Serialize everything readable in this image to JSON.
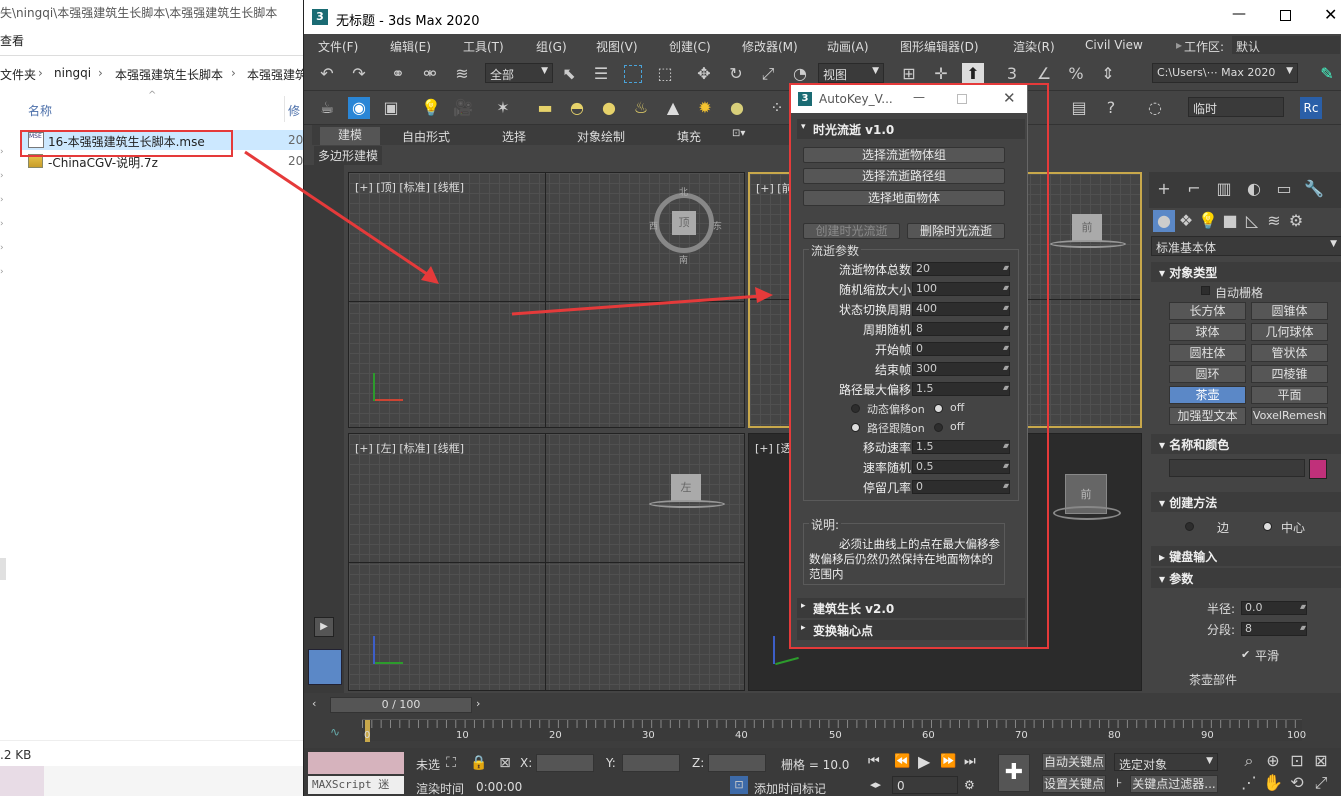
{
  "explorer": {
    "path_line": "失\\ningqi\\本强强建筑生长脚本\\本强强建筑生长脚本",
    "view_menu": "查看",
    "breadcrumb": [
      "文件夹",
      "ningqi",
      "本强强建筑生长脚本",
      "本强强建筑"
    ],
    "column_name": "名称",
    "column_modified": "修",
    "files": [
      {
        "name": "16-本强强建筑生长脚本.mse",
        "icon": "mse-file-icon",
        "date_prefix": "20"
      },
      {
        "name": "-ChinaCGV-说明.7z",
        "icon": "archive-icon",
        "date_prefix": "20"
      }
    ],
    "status_size": ".2 KB"
  },
  "max": {
    "title": "无标题 - 3ds Max 2020",
    "menu": [
      "文件(F)",
      "编辑(E)",
      "工具(T)",
      "组(G)",
      "视图(V)",
      "创建(C)",
      "修改器(M)",
      "动画(A)",
      "图形编辑器(D)",
      "渲染(R)",
      "Civil View"
    ],
    "workspace_label": "工作区:",
    "workspace_value": "默认",
    "selection_filter": "全部",
    "ref_coord": "视图",
    "path_display": "C:\\Users\\⋯ Max 2020",
    "named_set": "临时",
    "ribbon_tabs": [
      "建模",
      "自由形式",
      "选择",
      "对象绘制",
      "填充"
    ],
    "ribbon_sub": "多边形建模",
    "viewports": [
      {
        "label": "[+] [顶] [标准] [线框]"
      },
      {
        "label": "[+] [前"
      },
      {
        "label": "[+] [左] [标准] [线框]"
      },
      {
        "label": "[+] [透"
      }
    ],
    "viewcube_labels": {
      "top": "北",
      "left": "西",
      "right": "东",
      "bottom": "南",
      "top_face": "顶",
      "front_face": "前",
      "left_face": "左"
    },
    "command_panel": {
      "category": "标准基本体",
      "object_type_header": "对象类型",
      "auto_grid": "自动栅格",
      "buttons": [
        "长方体",
        "圆锥体",
        "球体",
        "几何球体",
        "圆柱体",
        "管状体",
        "圆环",
        "四棱锥",
        "茶壶",
        "平面",
        "加强型文本",
        "VoxelRemesh"
      ],
      "name_color_header": "名称和颜色",
      "object_color": "#c0307a",
      "creation_method_header": "创建方法",
      "edge_label": "边",
      "center_label": "中心",
      "keyboard_header": "键盘输入",
      "params_header": "参数",
      "radius_label": "半径:",
      "radius_value": "0.0",
      "segments_label": "分段:",
      "segments_value": "8",
      "smooth_label": "平滑",
      "teapot_parts": "茶壶部件"
    },
    "timeline": {
      "frame_display": "0 / 100",
      "ticks": [
        "0",
        "10",
        "20",
        "30",
        "40",
        "50",
        "60",
        "70",
        "80",
        "90",
        "100"
      ]
    },
    "status": {
      "maxscript_label": "MAXScript 迷",
      "not_selected": "未选",
      "x_label": "X:",
      "y_label": "Y:",
      "z_label": "Z:",
      "grid_label": "栅格 = 10.0",
      "render_time_label": "渲染时间",
      "render_time_value": "0:00:00",
      "add_time_tag": "添加时间标记",
      "auto_key": "自动关键点",
      "set_key": "设置关键点",
      "selected_obj": "选定对象",
      "key_filters": "关键点过滤器...",
      "frame_value": "0"
    }
  },
  "dialog": {
    "title": "AutoKey_V...",
    "section1": "时光流逝  v1.0",
    "btn_select_group": "选择流逝物体组",
    "btn_select_path": "选择流逝路径组",
    "btn_select_ground": "选择地面物体",
    "btn_create": "创建时光流逝",
    "btn_delete": "删除时光流逝",
    "params_group": "流逝参数",
    "params": [
      {
        "label": "流逝物体总数",
        "value": "20"
      },
      {
        "label": "随机缩放大小",
        "value": "100"
      },
      {
        "label": "状态切换周期",
        "value": "400"
      },
      {
        "label": "周期随机",
        "value": "8"
      },
      {
        "label": "开始帧",
        "value": "0"
      },
      {
        "label": "结束帧",
        "value": "300"
      },
      {
        "label": "路径最大偏移",
        "value": "1.5"
      }
    ],
    "dyn_offset_on": "动态偏移on",
    "dyn_offset_off": "off",
    "path_follow_on": "路径跟随on",
    "path_follow_off": "off",
    "params2": [
      {
        "label": "移动速率",
        "value": "1.5"
      },
      {
        "label": "速率随机",
        "value": "0.5"
      },
      {
        "label": "停留几率",
        "value": "0"
      }
    ],
    "note_label": "说明:",
    "note_text": "必须让曲线上的点在最大偏移参数偏移后仍然仍然保持在地面物体的范围内",
    "section2": "建筑生长  v2.0",
    "section3": "变换轴心点"
  },
  "colors": {
    "highlight_red": "#e53a3a",
    "active_blue": "#5b88c7",
    "viewport_active": "#c8a84b"
  }
}
